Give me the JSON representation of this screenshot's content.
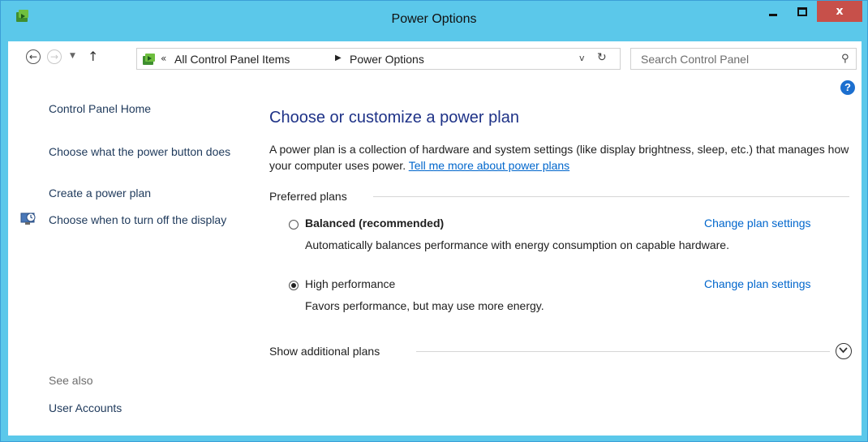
{
  "window": {
    "title": "Power Options",
    "min_label": "",
    "max_label": "",
    "close_label": "x"
  },
  "nav": {
    "back_glyph": "←",
    "forward_glyph": "→",
    "recent_glyph": "▼",
    "up_glyph": "↑",
    "address_chevron": "«",
    "breadcrumb": [
      "All Control Panel Items",
      "Power Options"
    ],
    "breadcrumb_sep": "▶",
    "dropdown_glyph": "v",
    "refresh_glyph": "↻",
    "search_placeholder": "Search Control Panel",
    "search_glyph": "⚲"
  },
  "sidebar": {
    "links": [
      "Control Panel Home",
      "Choose what the power button does",
      "Create a power plan",
      "Choose when to turn off the display"
    ],
    "see_also_label": "See also",
    "see_also_links": [
      "User Accounts"
    ]
  },
  "main": {
    "help_glyph": "?",
    "title": "Choose or customize a power plan",
    "description": "A power plan is a collection of hardware and system settings (like display brightness, sleep, etc.) that manages how your computer uses power.",
    "description_link": "Tell me more about power plans",
    "preferred_plans_label": "Preferred plans",
    "plans": [
      {
        "name": "Balanced (recommended)",
        "description": "Automatically balances performance with energy consumption on capable hardware.",
        "selected": false,
        "link": "Change plan settings"
      },
      {
        "name": "High performance",
        "description": "Favors performance, but may use more energy.",
        "selected": true,
        "link": "Change plan settings"
      }
    ],
    "show_additional_label": "Show additional plans"
  },
  "icons": {
    "app": "power-options-icon",
    "help": "help-icon",
    "expand": "chevron-down-circle-icon",
    "display_off": "clock-monitor-icon"
  },
  "colors": {
    "titlebar": "#5bc8ea",
    "close": "#c7504a",
    "link": "#0066cc",
    "heading": "#1e3287"
  }
}
